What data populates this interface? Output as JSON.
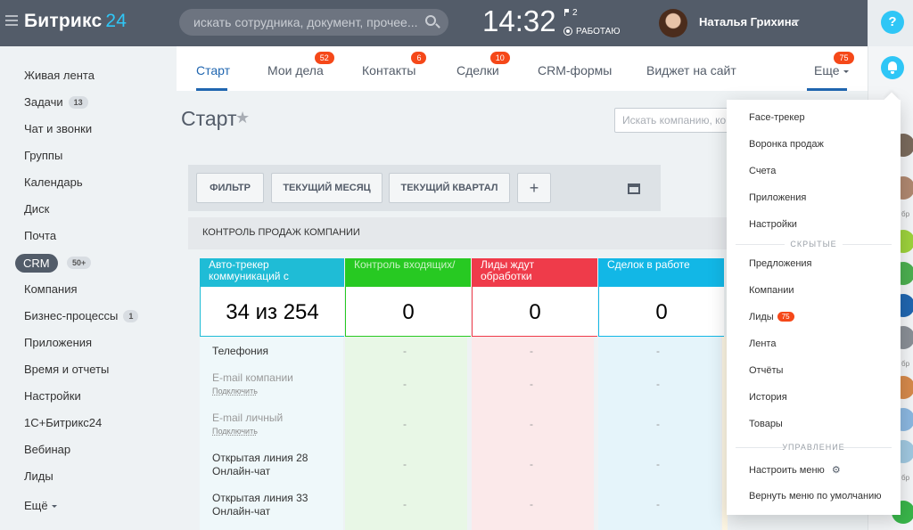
{
  "header": {
    "logo_main": "Битрикс",
    "logo_num": "24",
    "search_placeholder": "искать сотрудника, документ, прочее...",
    "clock": "14:32",
    "flag_count": "2",
    "status": "РАБОТАЮ",
    "user_name": "Наталья Грихина"
  },
  "sidebar": {
    "items": [
      {
        "label": "Живая лента"
      },
      {
        "label": "Задачи",
        "count": "13"
      },
      {
        "label": "Чат и звонки"
      },
      {
        "label": "Группы"
      },
      {
        "label": "Календарь"
      },
      {
        "label": "Диск"
      },
      {
        "label": "Почта"
      },
      {
        "label": "CRM",
        "count": "50+"
      },
      {
        "label": "Компания"
      },
      {
        "label": "Бизнес-процессы",
        "count": "1"
      },
      {
        "label": "Приложения"
      },
      {
        "label": "Время и отчеты"
      },
      {
        "label": "Настройки"
      },
      {
        "label": "1С+Битрикс24"
      },
      {
        "label": "Вебинар"
      },
      {
        "label": "Лиды"
      },
      {
        "label": "Ещё"
      }
    ]
  },
  "tabs": [
    {
      "label": "Старт"
    },
    {
      "label": "Мои дела",
      "badge": "52"
    },
    {
      "label": "Контакты",
      "badge": "6"
    },
    {
      "label": "Сделки",
      "badge": "10"
    },
    {
      "label": "CRM-формы"
    },
    {
      "label": "Виджет на сайт"
    },
    {
      "label": "Еще",
      "badge": "75"
    }
  ],
  "page": {
    "title": "Старт",
    "company_search_placeholder": "Искать компанию, ко"
  },
  "filters": {
    "filter": "ФИЛЬТР",
    "month": "ТЕКУЩИЙ МЕСЯЦ",
    "quarter": "ТЕКУЩИЙ КВАРТАЛ",
    "add": "+"
  },
  "control_title": "КОНТРОЛЬ ПРОДАЖ КОМПАНИИ",
  "widgets": [
    {
      "title": "Авто-трекер коммуникаций с",
      "value": "34 из 254",
      "color": "#1fbcd6"
    },
    {
      "title": "Контроль входящих/",
      "value": "0",
      "color": "#27c922"
    },
    {
      "title": "Лиды ждут обработки",
      "value": "0",
      "color": "#ef3b4a"
    },
    {
      "title": "Сделок в работе",
      "value": "0",
      "color": "#12b7e6"
    }
  ],
  "rows": [
    {
      "l1": "Телефония"
    },
    {
      "l1": "E-mail компании",
      "link": "Подключить"
    },
    {
      "l1": "E-mail личный",
      "link": "Подключить"
    },
    {
      "l1": "Открытая линия 28",
      "l2": "Онлайн-чат"
    },
    {
      "l1": "Открытая линия 33",
      "l2": "Онлайн-чат"
    }
  ],
  "dash": "-",
  "dropdown": {
    "items1": [
      "Face-трекер",
      "Воронка продаж",
      "Счета",
      "Приложения",
      "Настройки"
    ],
    "hidden_label": "СКРЫТЫЕ",
    "items2": [
      "Предложения",
      "Компании",
      "Лиды",
      "Лента",
      "Отчёты",
      "История",
      "Товары"
    ],
    "leads_badge": "75",
    "manage_label": "УПРАВЛЕНИЕ",
    "configure": "Настроить меню",
    "reset": "Вернуть меню по умолчанию"
  },
  "rightbar": {
    "help": "?",
    "user_label_short": "бр"
  }
}
